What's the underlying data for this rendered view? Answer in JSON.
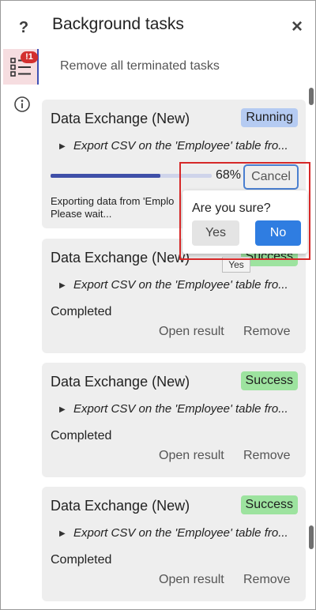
{
  "rail": {
    "help_label": "?",
    "tasks_badge": "1",
    "accent_color": "#3f51b5",
    "badge_color": "#d32f2f"
  },
  "header": {
    "title": "Background tasks",
    "close_label": "×",
    "remove_all_label": "Remove all terminated tasks"
  },
  "tasks": [
    {
      "title": "Data Exchange (New)",
      "status": "Running",
      "detail": "Export CSV on the 'Employee' table fro...",
      "progress_percent": 68,
      "progress_label": "68%",
      "cancel_label": "Cancel",
      "message_line1": "Exporting data from 'Emplo",
      "message_line2": "Please wait..."
    },
    {
      "title": "Data Exchange (New)",
      "status": "Success",
      "detail": "Export CSV on the 'Employee' table fro...",
      "state_text": "Completed",
      "open_label": "Open result",
      "remove_label": "Remove"
    },
    {
      "title": "Data Exchange (New)",
      "status": "Success",
      "detail": "Export CSV on the 'Employee' table fro...",
      "state_text": "Completed",
      "open_label": "Open result",
      "remove_label": "Remove"
    },
    {
      "title": "Data Exchange (New)",
      "status": "Success",
      "detail": "Export CSV on the 'Employee' table fro...",
      "state_text": "Completed",
      "open_label": "Open result",
      "remove_label": "Remove"
    }
  ],
  "confirm": {
    "question": "Are you sure?",
    "yes_label": "Yes",
    "no_label": "No",
    "tooltip": "Yes"
  },
  "colors": {
    "running": "#b5cbf2",
    "success": "#9de39f",
    "primary": "#2f7de1",
    "highlight": "#d62828"
  }
}
